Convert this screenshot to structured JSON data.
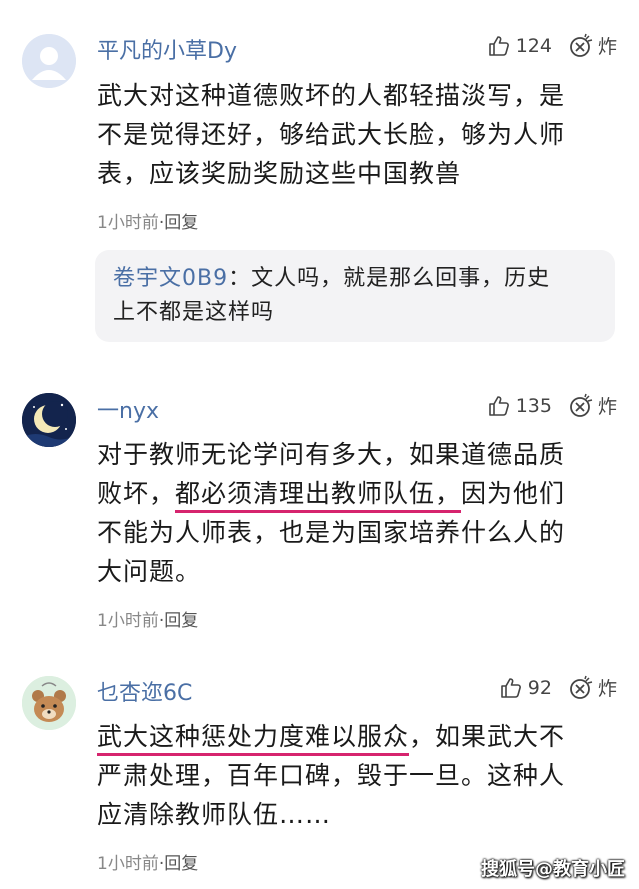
{
  "comments": [
    {
      "username": "平凡的小草Dy",
      "likes": "124",
      "bomb_label": "炸",
      "avatar": "default-person-avatar",
      "text_lines": [
        "武大对这种道德败坏的人都轻描淡写，是",
        "不是觉得还好，够给武大长脸，够为人师",
        "表，应该奖励奖励这些中国教兽"
      ],
      "time": "1小时前",
      "reply_label": "·回复",
      "reply": {
        "name": "卷宇文0B9",
        "separator": "：",
        "text_first": "文人吗，就是那么回事，历史",
        "text_second": "上不都是这样吗"
      }
    },
    {
      "username": "一nyx",
      "likes": "135",
      "bomb_label": "炸",
      "avatar": "moon-night-avatar",
      "line1": "对于教师无论学问有多大，如果道德品质",
      "line2_pre": "败坏，",
      "line2_underlined": "都必须清理出教师队伍，",
      "line2_post": "因为他们",
      "line3": "不能为人师表，也是为国家培养什么人的",
      "line4": "大问题。",
      "time": "1小时前",
      "reply_label": "·回复"
    },
    {
      "username": "乜杏迩6C",
      "likes": "92",
      "bomb_label": "炸",
      "avatar": "bear-cartoon-avatar",
      "line1_underlined": "武大这种惩处力度难以服众",
      "line1_post": "，如果武大不",
      "line2": "严肃处理，百年口碑，毁于一旦。这种人",
      "line3": "应清除教师队伍……",
      "time": "1小时前",
      "reply_label": "·回复"
    }
  ],
  "watermark": "搜狐号@教育小匠",
  "colors": {
    "username": "#4a6fa5",
    "underline": "#d6246e",
    "reply_bg": "#f3f3f5"
  }
}
